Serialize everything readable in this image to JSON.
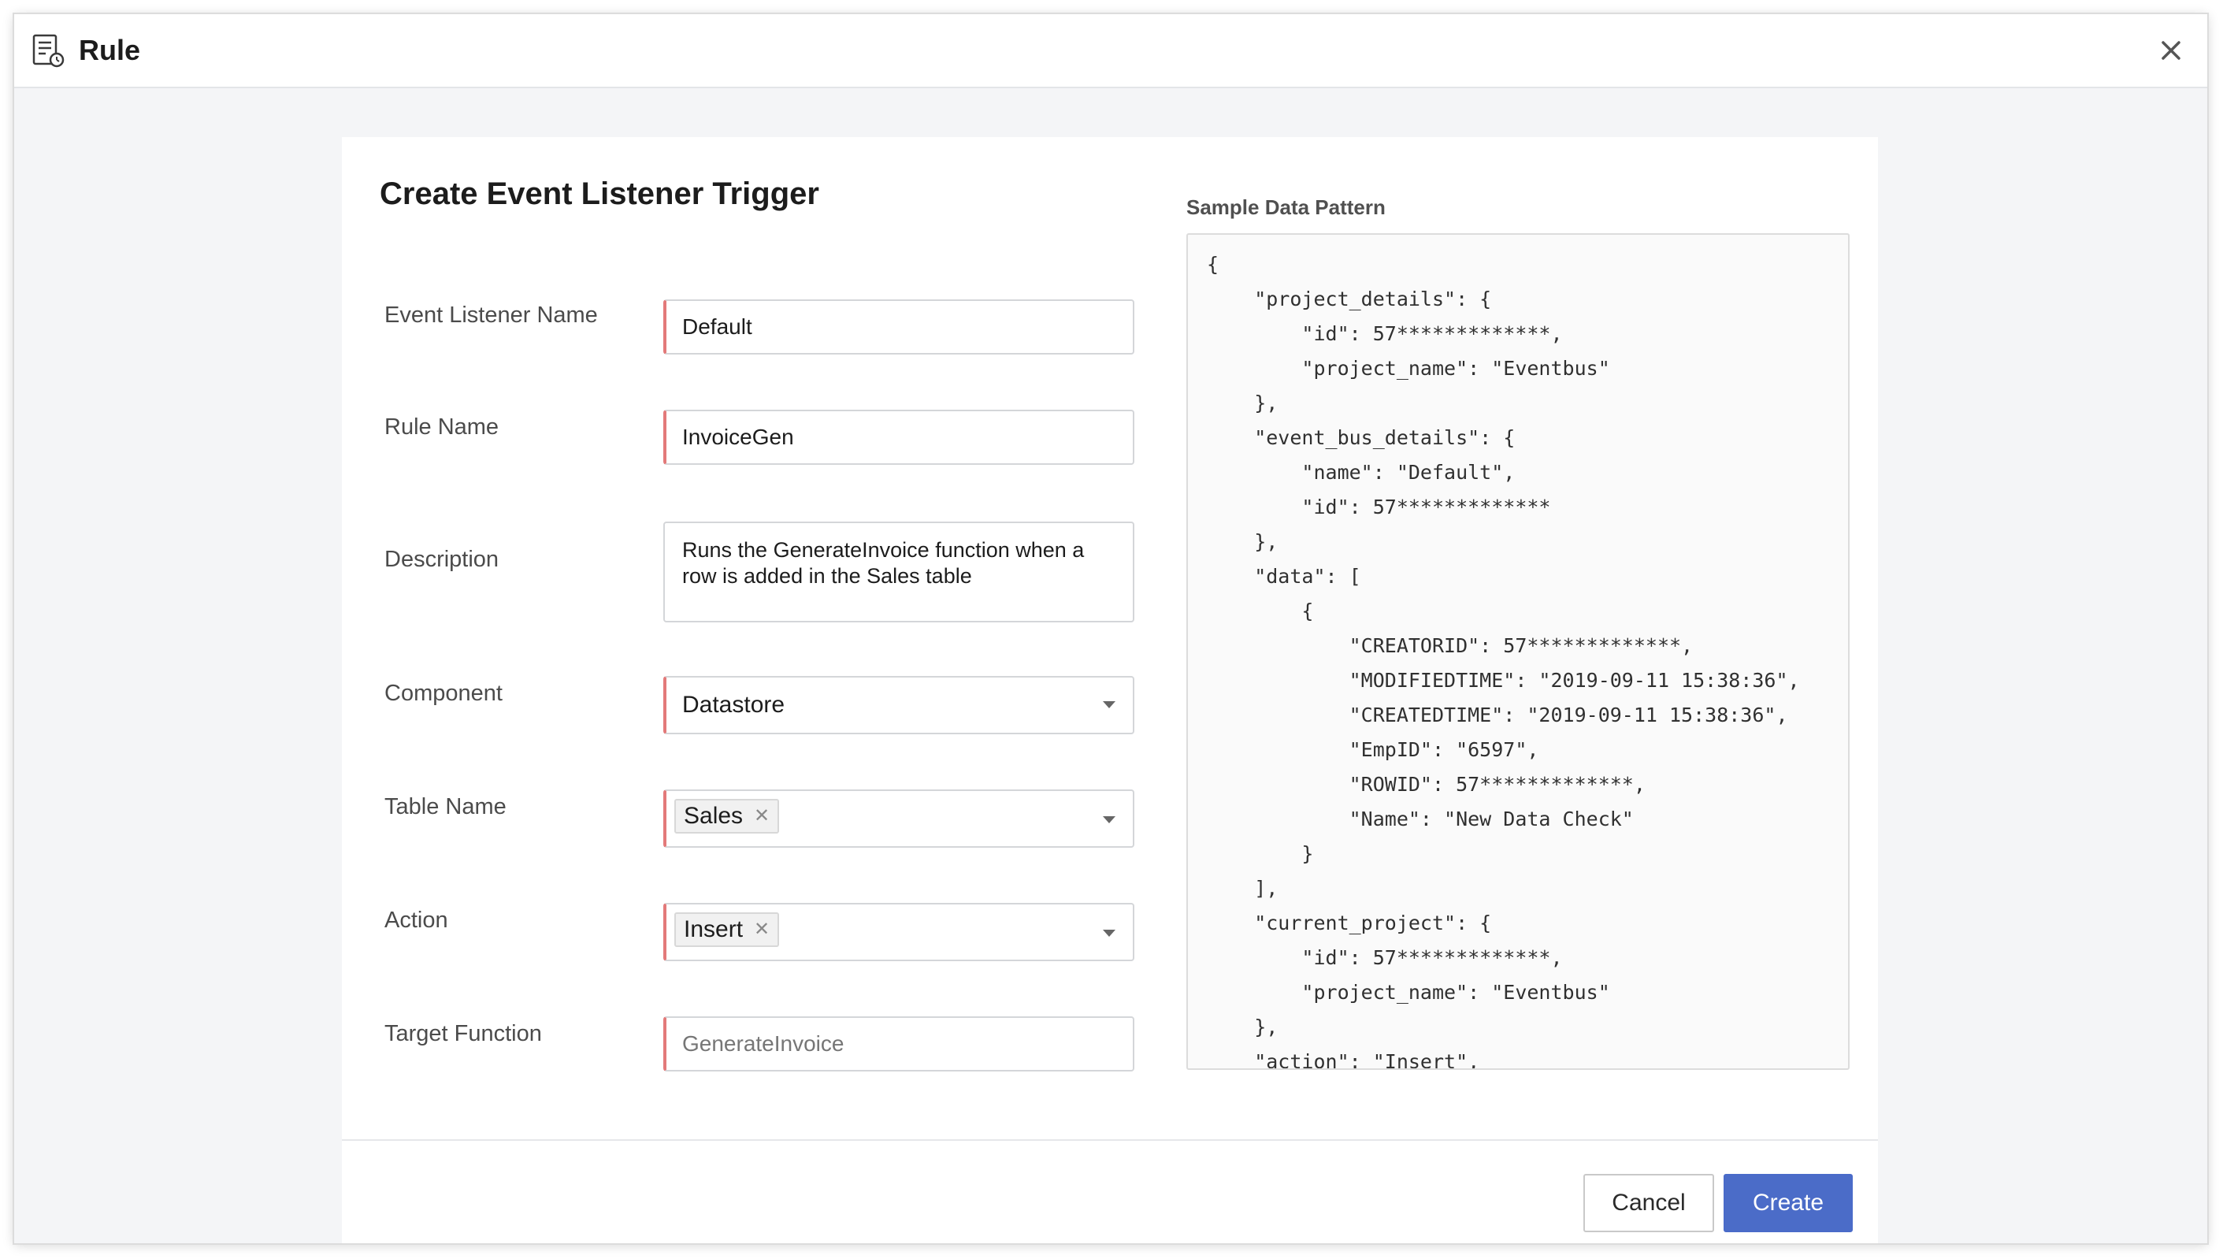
{
  "window": {
    "title": "Rule",
    "close_icon": "close-icon",
    "title_icon": "rule-document-icon"
  },
  "form": {
    "heading": "Create Event Listener Trigger",
    "event_listener_name": {
      "label": "Event Listener Name",
      "value": "Default"
    },
    "rule_name": {
      "label": "Rule Name",
      "value": "InvoiceGen"
    },
    "description": {
      "label": "Description",
      "value": "Runs the GenerateInvoice function when a row is added in the Sales table"
    },
    "component": {
      "label": "Component",
      "value": "Datastore"
    },
    "table_name": {
      "label": "Table Name",
      "chips": [
        "Sales"
      ]
    },
    "action": {
      "label": "Action",
      "chips": [
        "Insert"
      ]
    },
    "target_function": {
      "label": "Target Function",
      "placeholder": "GenerateInvoice"
    }
  },
  "sample": {
    "label": "Sample Data Pattern",
    "code": "{\n    \"project_details\": {\n        \"id\": 57*************,\n        \"project_name\": \"Eventbus\"\n    },\n    \"event_bus_details\": {\n        \"name\": \"Default\",\n        \"id\": 57*************\n    },\n    \"data\": [\n        {\n            \"CREATORID\": 57*************,\n            \"MODIFIEDTIME\": \"2019-09-11 15:38:36\",\n            \"CREATEDTIME\": \"2019-09-11 15:38:36\",\n            \"EmpID\": \"6597\",\n            \"ROWID\": 57*************,\n            \"Name\": \"New Data Check\"\n        }\n    ],\n    \"current_project\": {\n        \"id\": 57*************,\n        \"project_name\": \"Eventbus\"\n    },\n    \"action\": \"Insert\","
  },
  "footer": {
    "cancel_label": "Cancel",
    "create_label": "Create"
  },
  "colors": {
    "accent": "#4b6cc8",
    "required_marker": "#e37a7a"
  }
}
